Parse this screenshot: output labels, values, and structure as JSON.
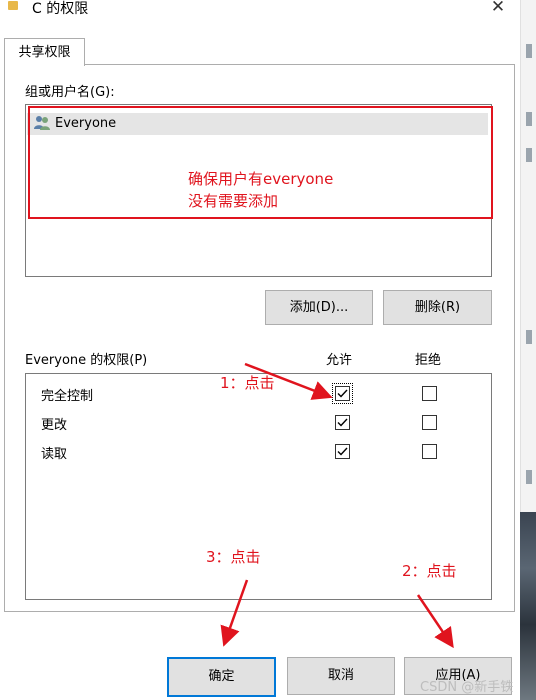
{
  "window": {
    "title": "C 的权限",
    "close_glyph": "✕"
  },
  "tab": {
    "label": "共享权限"
  },
  "groups": {
    "label": "组或用户名(G):",
    "users": [
      {
        "name": "Everyone",
        "icon": "users-group-icon"
      }
    ]
  },
  "buttons": {
    "add": "添加(D)...",
    "remove": "删除(R)",
    "ok": "确定",
    "cancel": "取消",
    "apply": "应用(A)"
  },
  "permissions": {
    "label": "Everyone 的权限(P)",
    "allow_header": "允许",
    "deny_header": "拒绝",
    "rows": [
      {
        "name": "完全控制",
        "allow": true,
        "deny": false
      },
      {
        "name": "更改",
        "allow": true,
        "deny": false
      },
      {
        "name": "读取",
        "allow": true,
        "deny": false
      }
    ]
  },
  "annotations": {
    "note_line1": "确保用户有everyone",
    "note_line2": "没有需要添加",
    "step1": "1：点击",
    "step2": "2：点击",
    "step3": "3：点击",
    "color": "#e0141e"
  },
  "watermark": "CSDN @新手铁",
  "colors": {
    "focus_border": "#0078d7",
    "button_bg": "#e1e1e1",
    "selected_row": "#e5e5e5"
  }
}
